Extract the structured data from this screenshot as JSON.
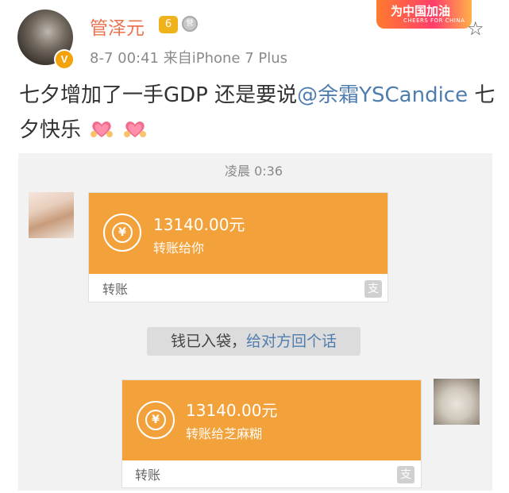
{
  "header": {
    "username": "管泽元",
    "avatar_badge": "V",
    "level_badge": "6",
    "medal_badge": "誉",
    "time": "8-7 00:41",
    "source": "来自iPhone 7 Plus",
    "banner": {
      "title": "为中国加油",
      "subtitle": "CHEERS FOR CHINA"
    },
    "favorite_icon": "☆"
  },
  "post": {
    "text_before": "七夕增加了一手GDP 还是要说",
    "mention": "@余霜YSCandice",
    "text_after": " 七夕快乐"
  },
  "chat": {
    "timestamp": "凌晨 0:36",
    "transfers": [
      {
        "amount": "13140.00元",
        "description": "转账给你",
        "footer": "转账"
      },
      {
        "amount": "13140.00元",
        "description": "转账给芝麻糊",
        "footer": "转账"
      }
    ],
    "system_message": {
      "text": "钱已入袋，",
      "link": "给对方回个话"
    },
    "currency_symbol": "¥",
    "pay_icon_glyph": "支"
  },
  "colors": {
    "username": "#eb7350",
    "mention": "#507daf",
    "transfer_card": "#f3a23b",
    "chat_background": "#f2f2f2"
  }
}
